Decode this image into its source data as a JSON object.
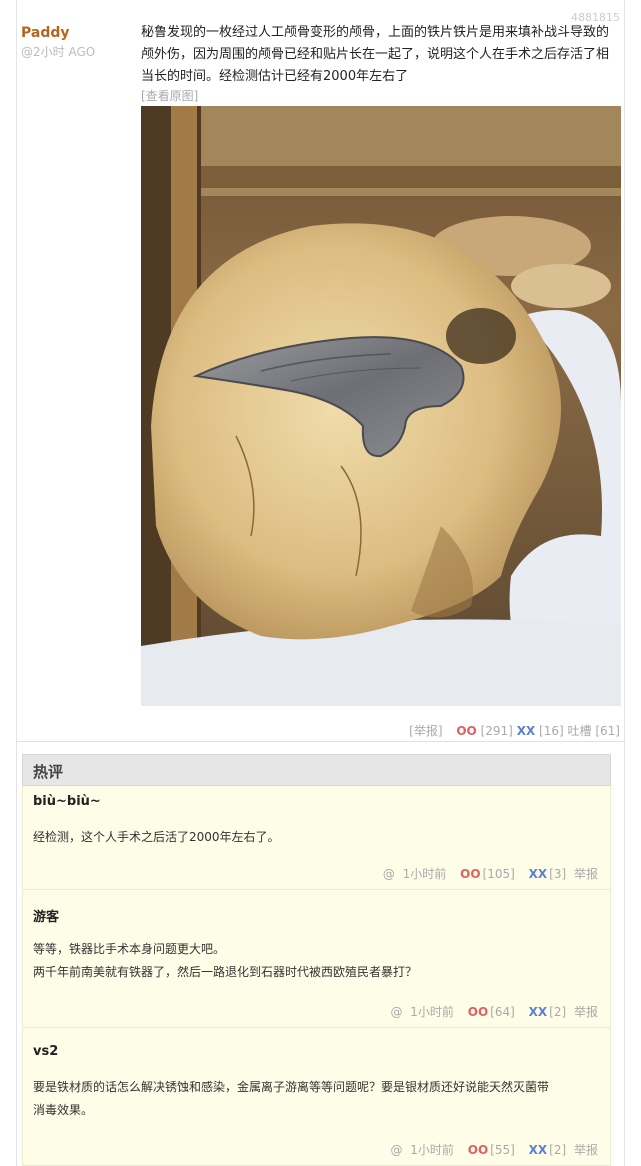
{
  "post": {
    "author": "Paddy",
    "time": "@2小时 AGO",
    "id": "4881815",
    "text": "秘鲁发现的一枚经过人工颅骨变形的颅骨，上面的铁片铁片是用来填补战斗导致的颅外伤，因为周围的颅骨已经和贴片长在一起了，说明这个人在手术之后存活了相当长的时间。经检测估计已经有2000年左右了",
    "view_original": "[查看原图]",
    "actions": {
      "report": "[举报]",
      "oo_label": "OO",
      "oo_count": "[291]",
      "xx_label": "XX",
      "xx_count": "[16]",
      "tucao_label": "吐槽",
      "tucao_count": "[61]"
    }
  },
  "hot_comments": {
    "title": "热评",
    "items": [
      {
        "author": "biù~biù~",
        "lines": [
          "经检测，这个人手术之后活了2000年左右了。"
        ],
        "at": "@",
        "time": "1小时前",
        "oo_label": "OO",
        "oo_count": "[105]",
        "xx_label": "XX",
        "xx_count": "[3]",
        "report": "举报"
      },
      {
        "author": "游客",
        "lines": [
          "等等，铁器比手术本身问题更大吧。",
          "两千年前南美就有铁器了，然后一路退化到石器时代被西欧殖民者暴打？"
        ],
        "at": "@",
        "time": "1小时前",
        "oo_label": "OO",
        "oo_count": "[64]",
        "xx_label": "XX",
        "xx_count": "[2]",
        "report": "举报"
      },
      {
        "author": "vs2",
        "lines": [
          "要是铁材质的话怎么解决锈蚀和感染，金属离子游离等等问题呢？要是银材质还好说能天然灭菌带",
          "消毒效果。"
        ],
        "at": "@",
        "time": "1小时前",
        "oo_label": "OO",
        "oo_count": "[55]",
        "xx_label": "XX",
        "xx_count": "[2]",
        "report": "举报"
      }
    ]
  }
}
